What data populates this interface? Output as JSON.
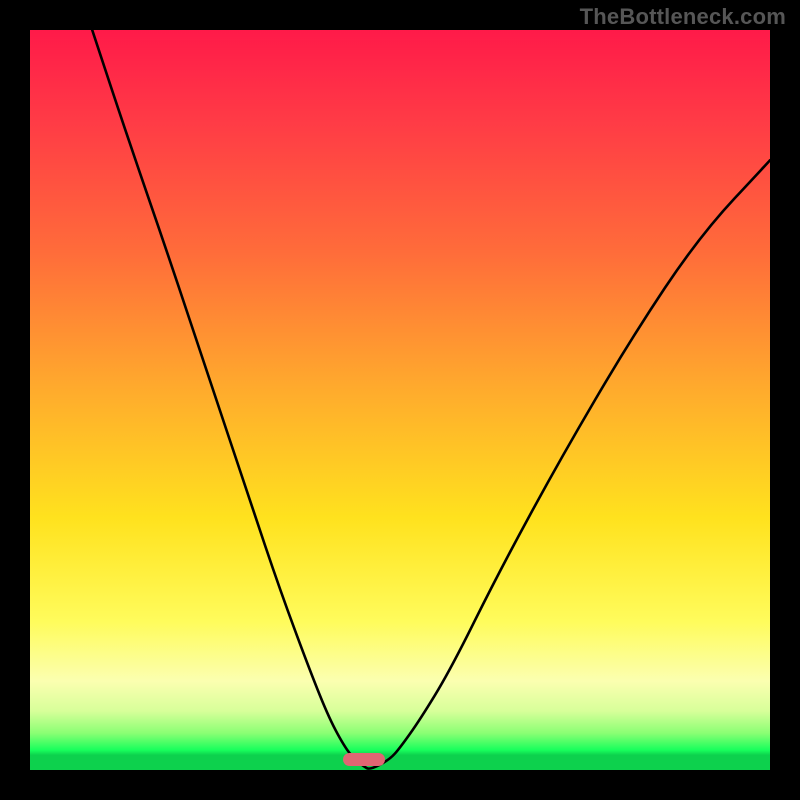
{
  "watermark": "TheBottleneck.com",
  "colors": {
    "frame_background": "#000000",
    "gradient_top": "#ff1a49",
    "gradient_mid": "#ffe21e",
    "gradient_bottom": "#0dd14d",
    "curve_stroke": "#000000",
    "marker_fill": "#e06673",
    "watermark_text": "#565656"
  },
  "chart_data": {
    "type": "line",
    "title": "",
    "xlabel": "",
    "ylabel": "",
    "xlim": [
      0,
      1
    ],
    "ylim": [
      0,
      1
    ],
    "note": "Axes have no visible tick labels; values are normalized plot-area fractions (0 = left/bottom, 1 = right/top). The curve is a V-shape: a steep descending left arm and a shallower ascending right arm meeting at a minimum that touches y≈0. A small rounded marker sits at the trough. Derived from pixel positions in a 740×740 plot area.",
    "series": [
      {
        "name": "curve",
        "x": [
          0.084,
          0.135,
          0.189,
          0.243,
          0.297,
          0.338,
          0.378,
          0.405,
          0.426,
          0.439,
          0.451,
          0.459,
          0.486,
          0.5,
          0.527,
          0.568,
          0.635,
          0.716,
          0.811,
          0.905,
          1.0
        ],
        "y": [
          1.0,
          0.846,
          0.689,
          0.527,
          0.365,
          0.243,
          0.135,
          0.068,
          0.03,
          0.014,
          0.005,
          0.0,
          0.014,
          0.03,
          0.068,
          0.135,
          0.27,
          0.419,
          0.581,
          0.722,
          0.824
        ]
      }
    ],
    "marker": {
      "shape": "rounded-bar",
      "x_center": 0.451,
      "y_center": 0.014,
      "width_frac": 0.057,
      "height_frac": 0.018
    },
    "background_gradient": {
      "direction": "vertical",
      "stops": [
        {
          "pos": 0.0,
          "color": "#ff1a49"
        },
        {
          "pos": 0.3,
          "color": "#ff6c3a"
        },
        {
          "pos": 0.66,
          "color": "#ffe21e"
        },
        {
          "pos": 0.88,
          "color": "#fbffb0"
        },
        {
          "pos": 0.97,
          "color": "#18ff5c"
        },
        {
          "pos": 1.0,
          "color": "#0dd14d"
        }
      ]
    }
  }
}
